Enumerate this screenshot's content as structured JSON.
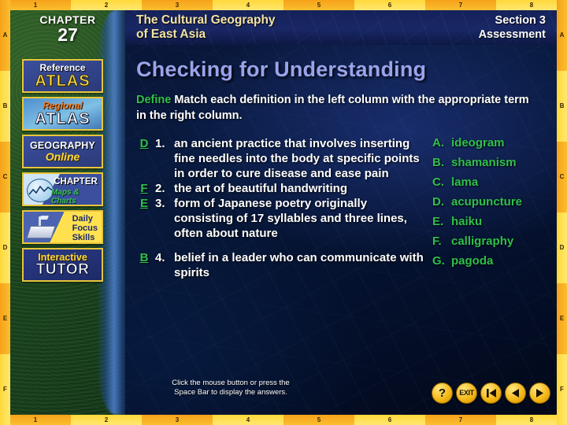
{
  "frame": {
    "top_ticks": [
      "1",
      "2",
      "3",
      "4",
      "5",
      "6",
      "7",
      "8"
    ],
    "bottom_ticks": [
      "1",
      "2",
      "3",
      "4",
      "5",
      "6",
      "7",
      "8"
    ],
    "left_ticks": [
      "A",
      "B",
      "C",
      "D",
      "E",
      "F"
    ],
    "right_ticks": [
      "A",
      "B",
      "C",
      "D",
      "E",
      "F"
    ]
  },
  "header": {
    "chapter_word": "CHAPTER",
    "chapter_number": "27",
    "book_title_line1": "The Cultural Geography",
    "book_title_line2": "of East Asia",
    "section_line1": "Section 3",
    "section_line2": "Assessment"
  },
  "sidebar": {
    "items": [
      {
        "name": "reference-atlas",
        "line1": "Reference",
        "line2": "ATLAS"
      },
      {
        "name": "regional-atlas",
        "line1": "Regional",
        "line2": "ATLAS"
      },
      {
        "name": "geography-online",
        "line1": "GEOGRAPHY",
        "line2": "Online"
      },
      {
        "name": "chapter-maps-charts",
        "line1": "CHAPTER",
        "line2": "Maps & Charts"
      },
      {
        "name": "daily-focus-skills",
        "line1": "Daily",
        "line2": "Focus",
        "line3": "Skills"
      },
      {
        "name": "interactive-tutor",
        "line1": "Interactive",
        "line2": "TUTOR"
      }
    ]
  },
  "main": {
    "title": "Checking for Understanding",
    "instruction_lead": "Define",
    "instruction_body": "Match each definition in the left column with the appropriate term in the right column.",
    "questions": [
      {
        "answer": "D",
        "number": "1.",
        "text": "an ancient practice that involves inserting fine needles into the body at specific points in order to cure disease and ease pain"
      },
      {
        "answer": "F",
        "number": "2.",
        "text": "the art of beautiful handwriting"
      },
      {
        "answer": "E",
        "number": "3.",
        "text": "form of Japanese poetry originally consisting of 17 syllables and three lines, often about nature"
      },
      {
        "answer": "B",
        "number": "4.",
        "text": "belief in a leader who can communicate with spirits"
      }
    ],
    "choices": [
      {
        "letter": "A.",
        "term": "ideogram"
      },
      {
        "letter": "B.",
        "term": "shamanism"
      },
      {
        "letter": "C.",
        "term": "lama"
      },
      {
        "letter": "D.",
        "term": "acupuncture"
      },
      {
        "letter": "E.",
        "term": "haiku"
      },
      {
        "letter": "F.",
        "term": "calligraphy"
      },
      {
        "letter": "G.",
        "term": "pagoda"
      }
    ]
  },
  "footer": {
    "hint_line1": "Click the mouse button or press the",
    "hint_line2": "Space Bar to display the answers."
  },
  "nav": {
    "buttons": [
      {
        "name": "help-button",
        "label": "?"
      },
      {
        "name": "exit-button",
        "label": "EXIT"
      },
      {
        "name": "first-slide-button",
        "label": ""
      },
      {
        "name": "previous-slide-button",
        "label": ""
      },
      {
        "name": "next-slide-button",
        "label": ""
      }
    ]
  },
  "colors": {
    "accent_green": "#2fc04a",
    "title_blue": "#9aa3ea",
    "banner_yellow": "#f3e3a4",
    "frame_orange": "#f6a21a",
    "frame_yellow": "#ffd83a"
  }
}
